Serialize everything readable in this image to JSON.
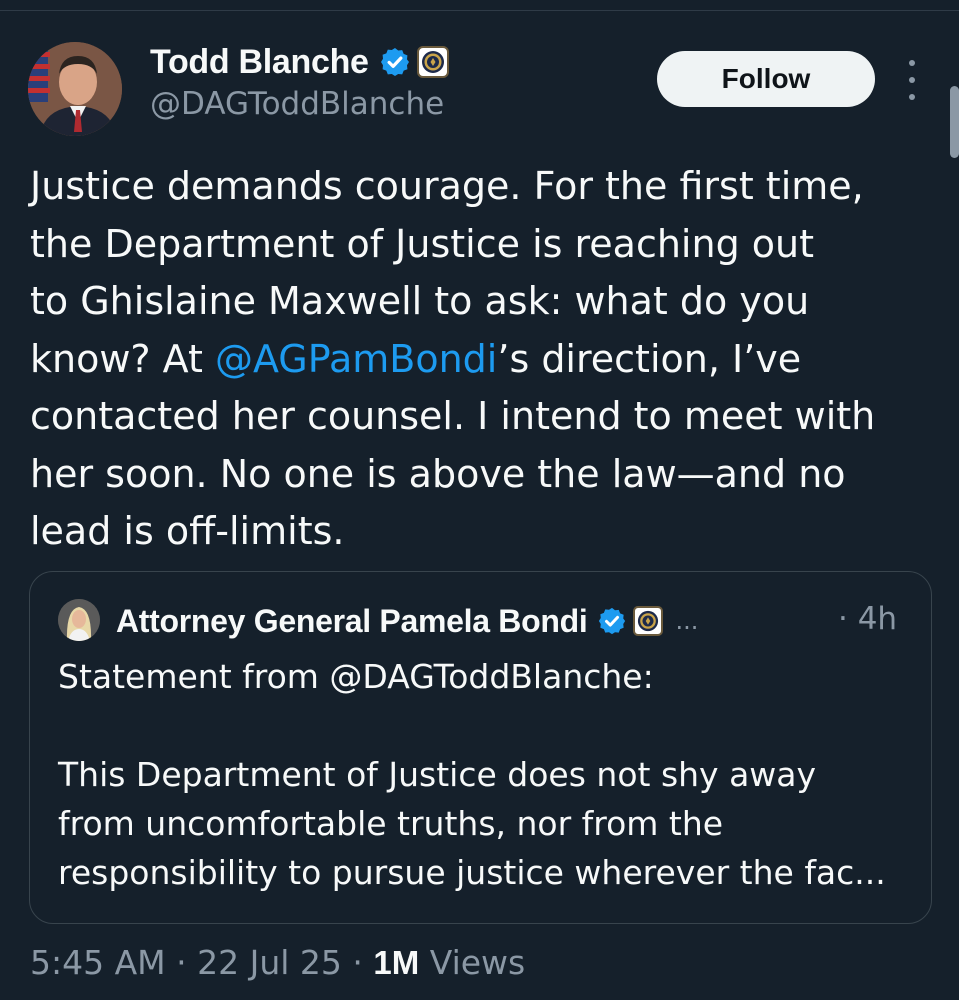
{
  "author": {
    "display_name": "Todd Blanche",
    "handle": "@DAGToddBlanche",
    "avatar_icon": "profile-photo-icon",
    "verified_icon": "verified-badge-icon",
    "affiliation_icon": "doj-seal-icon"
  },
  "actions": {
    "follow_label": "Follow",
    "more_icon": "more-vertical-icon"
  },
  "tweet": {
    "lines": [
      {
        "text": "Justice demands courage. For the first time,"
      },
      {
        "text": "the Department of Justice is reaching out"
      },
      {
        "text": "to Ghislaine Maxwell to ask: what do you"
      },
      {
        "before": "know? At ",
        "mention": "@AGPamBondi",
        "after": "’s direction, I’ve"
      },
      {
        "text": "contacted her counsel. I intend to meet with"
      },
      {
        "text": "her soon. No one is above the law—and no"
      },
      {
        "text": "lead is off-limits."
      }
    ]
  },
  "quote": {
    "display_name": "Attorney General Pamela Bondi",
    "truncation": "...",
    "time": "· 4h",
    "lines": [
      "Statement from @DAGToddBlanche:",
      "",
      "This Department of Justice does not shy away",
      "from uncomfortable truths, nor from the",
      "responsibility to pursue justice wherever the fac..."
    ]
  },
  "meta": {
    "time": "5:45 AM",
    "sep1": " · ",
    "date": "22 Jul 25",
    "sep2": " · ",
    "views_count": "1M",
    "views_label": " Views"
  },
  "colors": {
    "background": "#15202b",
    "text": "#f7f9f9",
    "secondary_text": "#8b98a5",
    "link": "#1d9bf0",
    "verified": "#1d9bf0",
    "follow_bg": "#eff3f4"
  }
}
